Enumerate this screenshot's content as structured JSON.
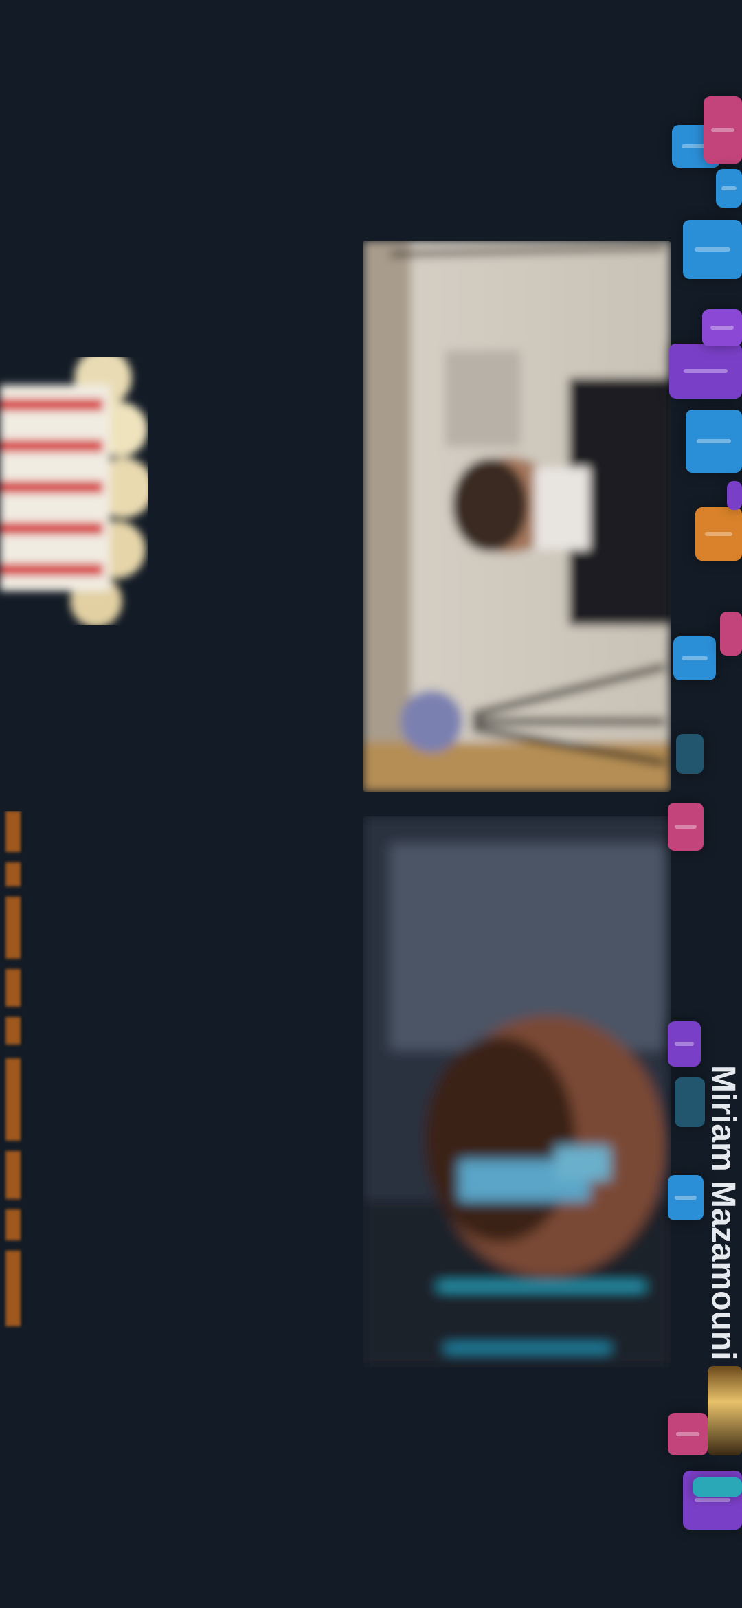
{
  "participant": {
    "name": "Miriam Mazamouni"
  },
  "headline": {
    "text": ""
  },
  "tiles": [
    {
      "label": "video-tile-1"
    },
    {
      "label": "video-tile-2"
    }
  ],
  "colors": {
    "background": "#131b26",
    "accent_orange": "#c06a14",
    "chip_blue": "#2b8fd8",
    "chip_purple": "#7a3fc7",
    "chip_pink": "#c2447a",
    "chip_orange": "#d9822b"
  },
  "icons": {
    "emblem": "popcorn-icon"
  }
}
